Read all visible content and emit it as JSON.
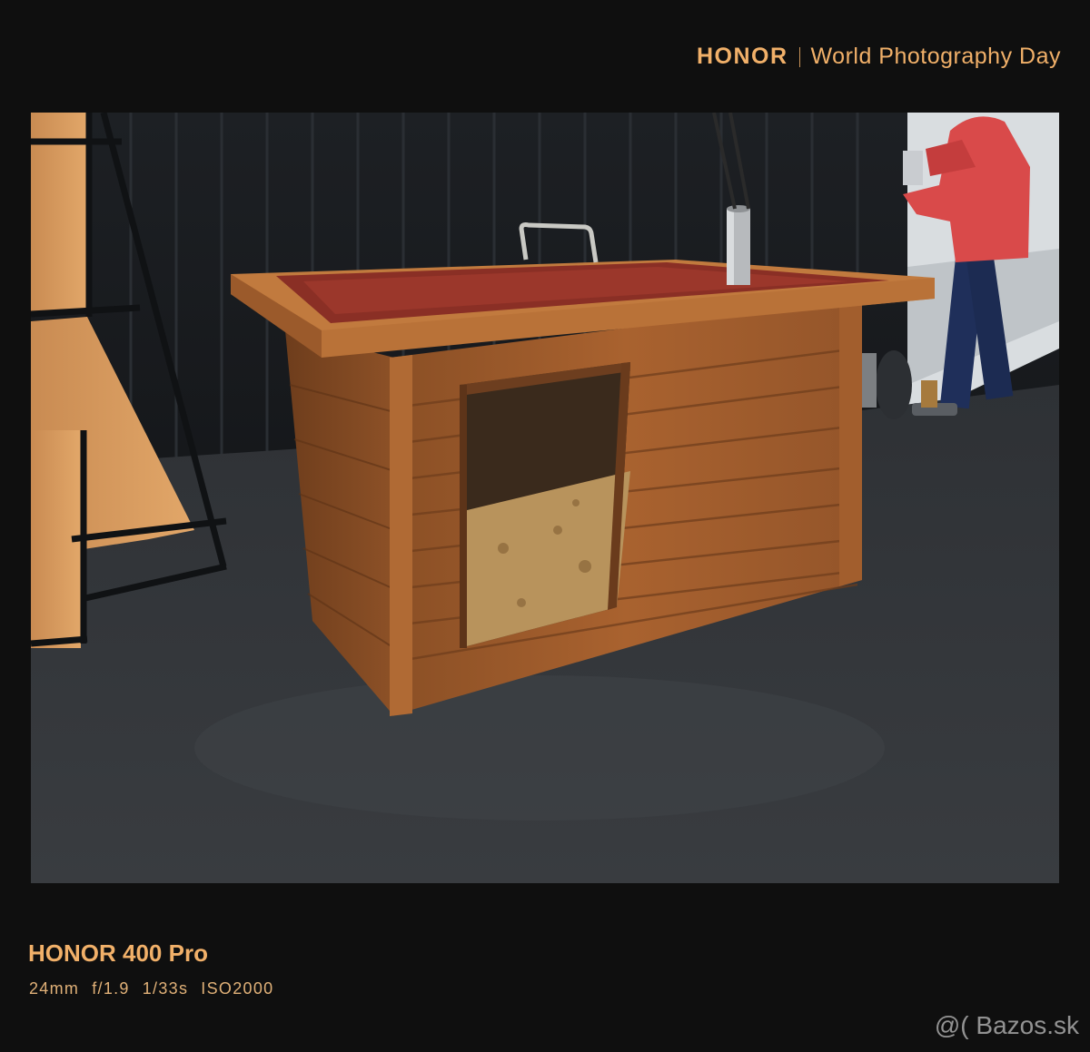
{
  "header": {
    "brand": "HONOR",
    "tagline": "World Photography Day"
  },
  "photo": {
    "scene": "wooden-dog-kennel-in-workshop"
  },
  "caption": {
    "model": "HONOR 400 Pro",
    "exif": [
      "24mm",
      "f/1.9",
      "1/33s",
      "ISO2000"
    ]
  },
  "watermark": {
    "text": "@( Bazos.sk"
  },
  "colors": {
    "accent": "#f1b069",
    "background": "#0f0f0f"
  }
}
